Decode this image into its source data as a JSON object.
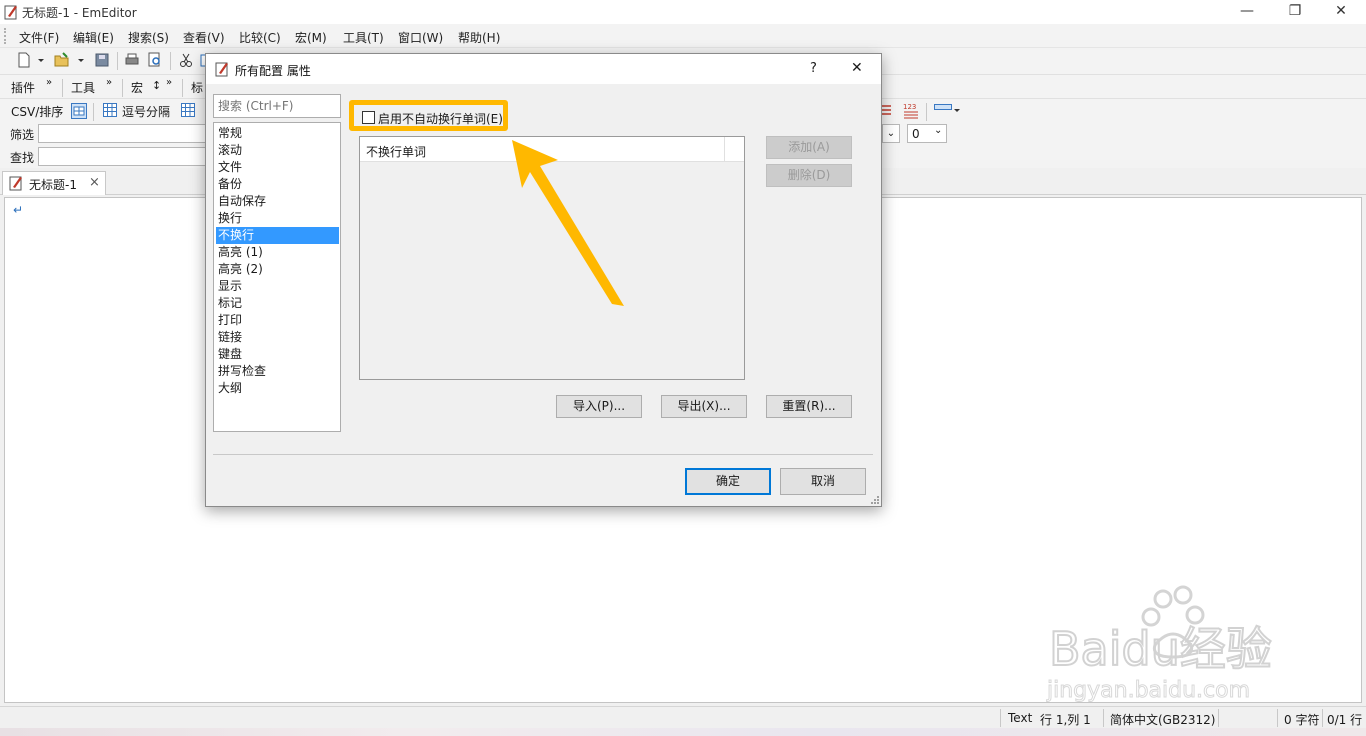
{
  "window": {
    "title": "无标题-1 - EmEditor",
    "minimize_glyph": "—",
    "restore_glyph": "❐",
    "close_glyph": "✕"
  },
  "menubar": {
    "items": [
      "文件(F)",
      "编辑(E)",
      "搜索(S)",
      "查看(V)",
      "比较(C)",
      "宏(M)",
      "工具(T)",
      "窗口(W)",
      "帮助(H)"
    ]
  },
  "toolbar2": {
    "plugins_label": "插件",
    "tools_label": "工具",
    "macro_label": "宏",
    "marker_label": "标",
    "overflow_glyph": "»"
  },
  "csvbar": {
    "csv_sort_label": "CSV/排序",
    "comma_label": "逗号分隔",
    "right_number": "0"
  },
  "filterbar": {
    "label": "筛选"
  },
  "findbar": {
    "label": "查找"
  },
  "tabs": {
    "doc_tab_label": "无标题-1",
    "close_glyph": "×"
  },
  "editor": {
    "return_mark": "↵"
  },
  "statusbar": {
    "mode": "Text",
    "position": "行 1,列 1",
    "encoding": "简体中文(GB2312)",
    "chars": "0 字符",
    "lines": "0/1 行"
  },
  "dialog": {
    "title": "所有配置 属性",
    "help_glyph": "?",
    "close_glyph": "✕",
    "search_placeholder": "搜索 (Ctrl+F)",
    "categories": [
      "常规",
      "滚动",
      "文件",
      "备份",
      "自动保存",
      "换行",
      "不换行",
      "高亮 (1)",
      "高亮 (2)",
      "显示",
      "标记",
      "打印",
      "链接",
      "键盘",
      "拼写检查",
      "大纲"
    ],
    "selected_category": "不换行",
    "enable_checkbox_label": "启用不自动换行单词(E)",
    "enable_checkbox_checked": false,
    "words_column_header": "不换行单词",
    "add_button": "添加(A)",
    "delete_button": "删除(D)",
    "import_button": "导入(P)...",
    "export_button": "导出(X)...",
    "reset_button": "重置(R)...",
    "ok_button": "确定",
    "cancel_button": "取消"
  },
  "overlay": {
    "highlight_color": "#ffb800",
    "arrow_color": "#ffb800",
    "watermark_brand": "Baidu经验",
    "watermark_url": "jingyan.baidu.com"
  }
}
